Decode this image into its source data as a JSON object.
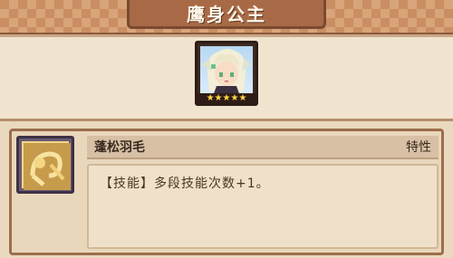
{
  "header": {
    "title": "鹰身公主"
  },
  "portrait": {
    "icon": "harpy-princess-portrait",
    "stars": [
      "★",
      "★",
      "★",
      "★",
      "★"
    ]
  },
  "skill": {
    "icon": "feather-skill-icon",
    "name": "蓬松羽毛",
    "type": "特性",
    "description": "【技能】多段技能次数+1。"
  },
  "colors": {
    "title_bg": "#c98e62",
    "star": "#ffd64a",
    "panel_border": "#9c6e4c"
  }
}
